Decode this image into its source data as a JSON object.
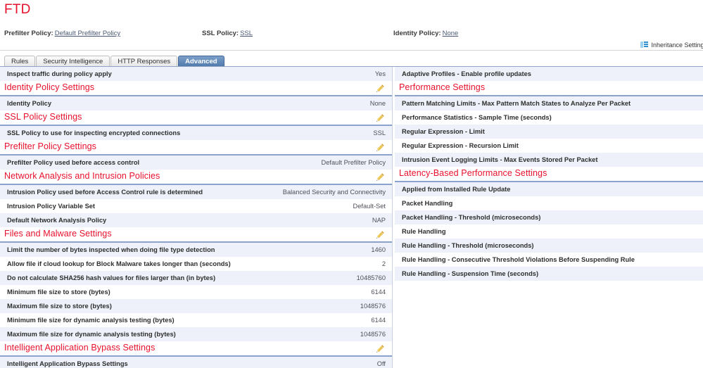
{
  "header": {
    "title": "FTD",
    "policies": [
      {
        "label": "Prefilter Policy:",
        "value": "Default Prefilter Policy"
      },
      {
        "label": "SSL Policy:",
        "value": "SSL"
      },
      {
        "label": "Identity Policy:",
        "value": "None"
      }
    ],
    "inheritance_label": "Inheritance Settings",
    "inheritance_icon": "inheritance-icon"
  },
  "tabs": [
    {
      "label": "Rules",
      "active": false
    },
    {
      "label": "Security Intelligence",
      "active": false
    },
    {
      "label": "HTTP Responses",
      "active": false
    },
    {
      "label": "Advanced",
      "active": true
    }
  ],
  "left_column": {
    "top_row": {
      "key": "Inspect traffic during policy apply",
      "value": "Yes"
    },
    "sections": [
      {
        "title": "Identity Policy Settings",
        "edit_icon": "pencil-icon",
        "rows": [
          {
            "key": "Identity Policy",
            "value": "None"
          }
        ]
      },
      {
        "title": "SSL Policy Settings",
        "edit_icon": "pencil-icon",
        "rows": [
          {
            "key": "SSL Policy to use for inspecting encrypted connections",
            "value": "SSL"
          }
        ]
      },
      {
        "title": "Prefilter Policy Settings",
        "edit_icon": "pencil-icon",
        "rows": [
          {
            "key": "Prefilter Policy used before access control",
            "value": "Default Prefilter Policy"
          }
        ]
      },
      {
        "title": "Network Analysis and Intrusion Policies",
        "edit_icon": "pencil-icon",
        "rows": [
          {
            "key": "Intrusion Policy used before Access Control rule is determined",
            "value": "Balanced Security and Connectivity"
          },
          {
            "key": "Intrusion Policy Variable Set",
            "value": "Default-Set"
          },
          {
            "key": "Default Network Analysis Policy",
            "value": "NAP"
          }
        ]
      },
      {
        "title": "Files and Malware Settings",
        "edit_icon": "pencil-icon",
        "rows": [
          {
            "key": "Limit the number of bytes inspected when doing file type detection",
            "value": "1460"
          },
          {
            "key": "Allow file if cloud lookup for Block Malware takes longer than (seconds)",
            "value": "2"
          },
          {
            "key": "Do not calculate SHA256 hash values for files larger than (in bytes)",
            "value": "10485760"
          },
          {
            "key": "Minimum file size to store (bytes)",
            "value": "6144"
          },
          {
            "key": "Maximum file size to store (bytes)",
            "value": "1048576"
          },
          {
            "key": "Minimum file size for dynamic analysis testing (bytes)",
            "value": "6144"
          },
          {
            "key": "Maximum file size for dynamic analysis testing (bytes)",
            "value": "1048576"
          }
        ]
      },
      {
        "title": "Intelligent Application Bypass Settings",
        "edit_icon": "pencil-icon",
        "rows": [
          {
            "key": "Intelligent Application Bypass Settings",
            "value": "Off"
          }
        ]
      }
    ]
  },
  "right_column": {
    "top_row": {
      "key": "Adaptive Profiles - Enable profile updates",
      "value": ""
    },
    "sections": [
      {
        "title": "Performance Settings",
        "edit_icon": "",
        "rows": [
          {
            "key": "Pattern Matching Limits - Max Pattern Match States to Analyze Per Packet",
            "value": ""
          },
          {
            "key": "Performance Statistics - Sample Time (seconds)",
            "value": ""
          },
          {
            "key": "Regular Expression - Limit",
            "value": ""
          },
          {
            "key": "Regular Expression - Recursion Limit",
            "value": ""
          },
          {
            "key": "Intrusion Event Logging Limits - Max Events Stored Per Packet",
            "value": ""
          }
        ]
      },
      {
        "title": "Latency-Based Performance Settings",
        "edit_icon": "",
        "rows": [
          {
            "key": "Applied from Installed Rule Update",
            "value": ""
          },
          {
            "key": "Packet Handling",
            "value": ""
          },
          {
            "key": "Packet Handling - Threshold (microseconds)",
            "value": ""
          },
          {
            "key": "Rule Handling",
            "value": ""
          },
          {
            "key": "Rule Handling - Threshold (microseconds)",
            "value": ""
          },
          {
            "key": "Rule Handling - Consecutive Threshold Violations Before Suspending Rule",
            "value": ""
          },
          {
            "key": "Rule Handling - Suspension Time (seconds)",
            "value": ""
          }
        ]
      }
    ]
  },
  "colors": {
    "accent_red": "#e8112d",
    "section_rule": "#8aa3cc",
    "row_alt": "#eef1f9",
    "tab_active": "#4f79ab",
    "link": "#4a5a74"
  }
}
